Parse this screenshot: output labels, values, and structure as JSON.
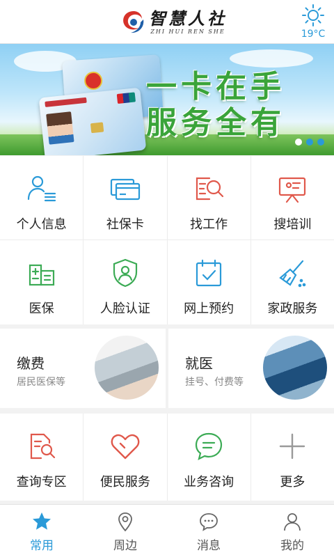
{
  "header": {
    "logo_cn": "智慧人社",
    "logo_en": "ZHI HUI REN SHE",
    "weather_icon": "sun-icon",
    "temperature": "19°C"
  },
  "banner": {
    "slogan_line1": "一卡在手",
    "slogan_line2": "服务全有",
    "slide_count": 3,
    "active_slide": 1
  },
  "services_primary": [
    {
      "label": "个人信息",
      "icon": "person-info-icon"
    },
    {
      "label": "社保卡",
      "icon": "card-icon"
    },
    {
      "label": "找工作",
      "icon": "job-search-icon"
    },
    {
      "label": "搜培训",
      "icon": "training-icon"
    },
    {
      "label": "医保",
      "icon": "hospital-icon"
    },
    {
      "label": "人脸认证",
      "icon": "face-shield-icon"
    },
    {
      "label": "网上预约",
      "icon": "calendar-check-icon"
    },
    {
      "label": "家政服务",
      "icon": "broom-icon"
    }
  ],
  "feature_cards": [
    {
      "title": "缴费",
      "subtitle": "居民医保等"
    },
    {
      "title": "就医",
      "subtitle": "挂号、付费等"
    }
  ],
  "services_secondary": [
    {
      "label": "查询专区",
      "icon": "document-search-icon"
    },
    {
      "label": "便民服务",
      "icon": "heart-icon"
    },
    {
      "label": "业务咨询",
      "icon": "chat-icon"
    },
    {
      "label": "更多",
      "icon": "plus-icon"
    }
  ],
  "tabbar": [
    {
      "label": "常用",
      "icon": "star-icon",
      "active": true
    },
    {
      "label": "周边",
      "icon": "location-pin-icon",
      "active": false
    },
    {
      "label": "消息",
      "icon": "message-icon",
      "active": false
    },
    {
      "label": "我的",
      "icon": "user-icon",
      "active": false
    }
  ],
  "colors": {
    "accent_blue": "#2a9ad8",
    "icon_red": "#e0584b",
    "icon_green": "#3cab55",
    "slogan_green": "#3aa43a"
  }
}
